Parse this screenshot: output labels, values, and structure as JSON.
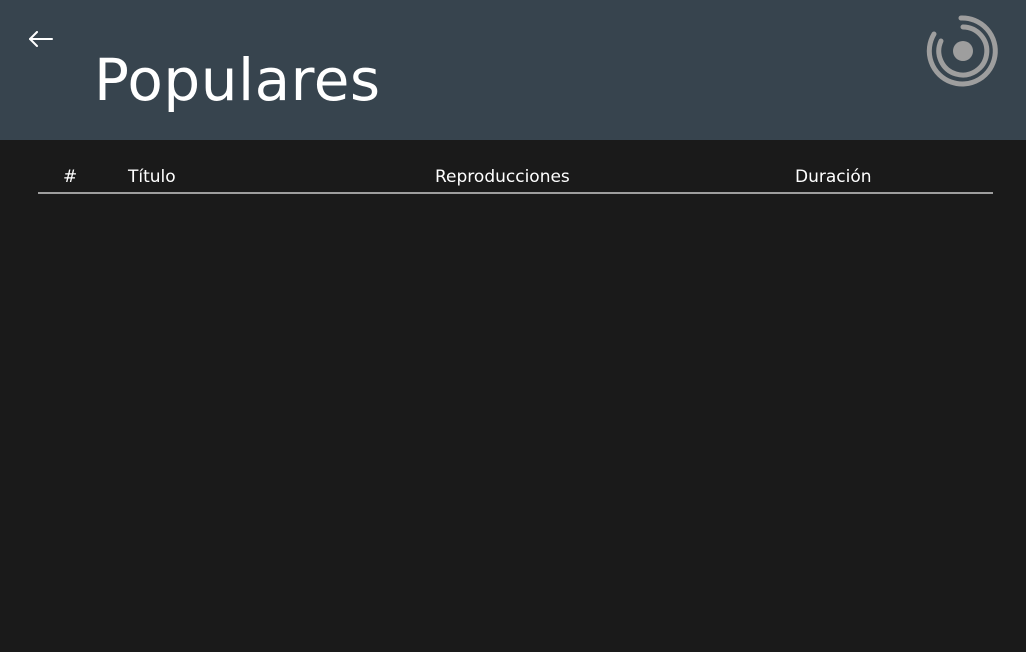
{
  "header": {
    "title": "Populares",
    "back_icon": "arrow-left-icon",
    "logo_icon": "app-logo-icon",
    "background_color": "#37444e"
  },
  "table": {
    "columns": [
      {
        "key": "number",
        "label": "#"
      },
      {
        "key": "title",
        "label": "Título"
      },
      {
        "key": "plays",
        "label": "Reproducciones"
      },
      {
        "key": "duration",
        "label": "Duración"
      }
    ],
    "rows": []
  },
  "theme": {
    "page_background": "#1a1a1a",
    "text_color": "#ffffff",
    "divider_color": "#9e9e9e",
    "logo_color": "#9e9e9e"
  }
}
